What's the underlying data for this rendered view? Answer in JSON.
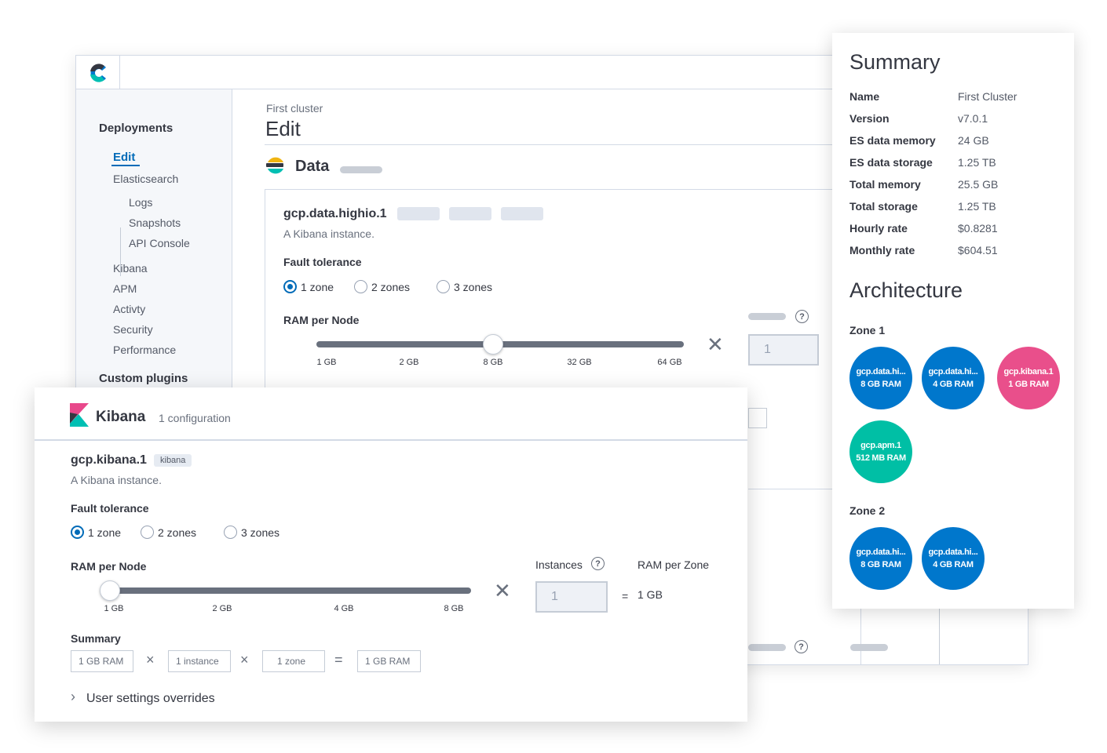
{
  "app": {
    "sidebar": {
      "deployments_heading": "Deployments",
      "edit": "Edit",
      "elasticsearch": "Elasticsearch",
      "logs": "Logs",
      "snapshots": "Snapshots",
      "api_console": "API Console",
      "kibana": "Kibana",
      "apm": "APM",
      "activity": "Activty",
      "security": "Security",
      "performance": "Performance",
      "custom_plugins_heading": "Custom plugins"
    },
    "breadcrumb": "First cluster",
    "page_title": "Edit",
    "section_title": "Data",
    "data_panel": {
      "name": "gcp.data.highio.1",
      "description": "A Kibana instance.",
      "fault_tolerance_label": "Fault tolerance",
      "zones": [
        "1 zone",
        "2 zones",
        "3 zones"
      ],
      "selected_zone": "1 zone",
      "ram_label": "RAM per Node",
      "ram_ticks": [
        "1 GB",
        "2 GB",
        "8 GB",
        "32 GB",
        "64 GB"
      ],
      "ram_selected": "8 GB",
      "instances_value": "1",
      "help_glyph": "?"
    }
  },
  "summary": {
    "title": "Summary",
    "rows": [
      {
        "key": "Name",
        "value": "First Cluster"
      },
      {
        "key": "Version",
        "value": "v7.0.1"
      },
      {
        "key": "ES data memory",
        "value": "24 GB"
      },
      {
        "key": "ES data storage",
        "value": "1.25 TB"
      },
      {
        "key": "Total memory",
        "value": "25.5 GB"
      },
      {
        "key": "Total storage",
        "value": "1.25 TB"
      },
      {
        "key": "Hourly rate",
        "value": "$0.8281"
      },
      {
        "key": "Monthly rate",
        "value": "$604.51"
      }
    ],
    "architecture_title": "Architecture",
    "zone1_label": "Zone 1",
    "zone1_nodes": [
      {
        "name": "gcp.data.hi...",
        "ram": "8 GB RAM",
        "color": "#0077cc"
      },
      {
        "name": "gcp.data.hi...",
        "ram": "4 GB RAM",
        "color": "#0077cc"
      },
      {
        "name": "gcp.kibana.1",
        "ram": "1 GB RAM",
        "color": "#e94f8b"
      },
      {
        "name": "gcp.apm.1",
        "ram": "512 MB RAM",
        "color": "#00bfa5"
      }
    ],
    "zone2_label": "Zone 2",
    "zone2_nodes": [
      {
        "name": "gcp.data.hi...",
        "ram": "8 GB RAM",
        "color": "#0077cc"
      },
      {
        "name": "gcp.data.hi...",
        "ram": "4 GB RAM",
        "color": "#0077cc"
      }
    ]
  },
  "kibana": {
    "title": "Kibana",
    "config_count": "1 configuration",
    "instance_name": "gcp.kibana.1",
    "badge": "kibana",
    "description": "A Kibana instance.",
    "fault_tolerance_label": "Fault tolerance",
    "zones": [
      "1 zone",
      "2 zones",
      "3 zones"
    ],
    "selected_zone": "1 zone",
    "ram_label": "RAM per Node",
    "ram_ticks": [
      "1 GB",
      "2 GB",
      "4 GB",
      "8 GB"
    ],
    "ram_selected": "1 GB",
    "instances_label": "Instances",
    "instances_value": "1",
    "ram_per_zone_label": "RAM per Zone",
    "equals": "=",
    "ram_per_zone_value": "1 GB",
    "summary_label": "Summary",
    "summary_boxes": [
      "1 GB RAM",
      "1 instance",
      "1 zone",
      "1 GB RAM"
    ],
    "times": "×",
    "eq_op": "=",
    "user_settings": "User settings overrides",
    "help_glyph": "?"
  },
  "colors": {
    "accent": "#006bb8",
    "elastic_blue": "#0077cc",
    "kibana_pink": "#e94f8b",
    "apm_teal": "#00bfa5"
  },
  "icons": [
    "elastic-cloud-logo-icon",
    "elasticsearch-logo-icon",
    "kibana-logo-icon",
    "help-icon",
    "close-icon",
    "chevron-right-icon"
  ]
}
